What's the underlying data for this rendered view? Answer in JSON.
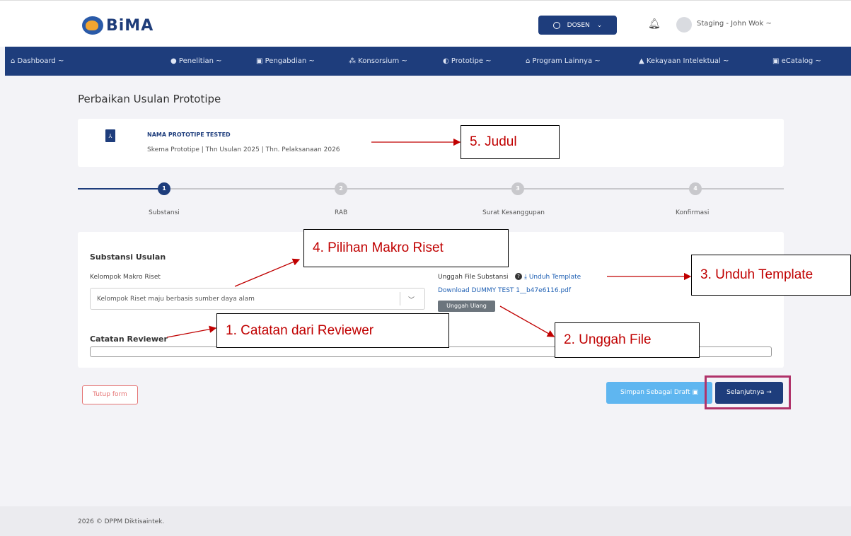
{
  "header": {
    "logo_text": "BiMA",
    "role_button": "DOSEN",
    "user_name": "Staging - John Wok ~"
  },
  "nav": {
    "items": [
      "⌂ Dashboard ~",
      "● Penelitian ~",
      "▣ Pengabdian ~",
      "⁂ Konsorsium ~",
      "◐ Prototipe ~",
      "⌂ Program Lainnya ~",
      "▲ Kekayaan Intelektual ~",
      "▣ eCatalog ~"
    ]
  },
  "page": {
    "title": "Perbaikan Usulan Prototipe",
    "prototype_name": "NAMA PROTOTIPE TESTED",
    "prototype_meta": "Skema Prototipe | Thn Usulan 2025 | Thn. Pelaksanaan 2026"
  },
  "stepper": {
    "steps": [
      {
        "num": "1",
        "label": "Substansi"
      },
      {
        "num": "2",
        "label": "RAB"
      },
      {
        "num": "3",
        "label": "Surat Kesanggupan"
      },
      {
        "num": "4",
        "label": "Konfirmasi"
      }
    ]
  },
  "form": {
    "section_title": "Substansi Usulan",
    "makro_label": "Kelompok Makro Riset",
    "makro_value": "Kelompok Riset maju berbasis sumber daya alam",
    "upload_label": "Unggah File Substansi",
    "download_template": "Unduh Template",
    "file_link": "Download DUMMY TEST 1__b47e6116.pdf",
    "reupload_button": "Unggah Ulang",
    "reviewer_label": "Catatan Reviewer"
  },
  "actions": {
    "close_form": "Tutup form",
    "save_draft": "Simpan Sebagai Draft",
    "next": "Selanjutnya →"
  },
  "footer": {
    "text": "2026 © DPPM Diktisaintek."
  },
  "annotations": {
    "a1": "1.  Catatan dari Reviewer",
    "a2": "2.  Unggah File",
    "a3": "3.  Unduh Template",
    "a4": "4.  Pilihan Makro Riset",
    "a5": "5.  Judul"
  },
  "colors": {
    "primary": "#1e3d7c",
    "annotation": "#c00000",
    "draft": "#5fb6f0",
    "highlight": "#b0336a"
  }
}
